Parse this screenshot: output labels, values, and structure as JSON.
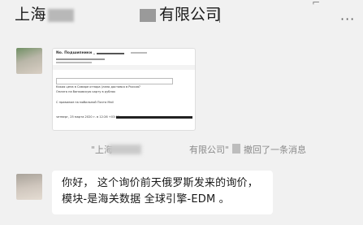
{
  "header": {
    "title_prefix": "上海",
    "title_suffix": "有限公司",
    "more_icon": "more-icon"
  },
  "messages": [
    {
      "type": "document",
      "preview": {
        "header_text": "No. Подшипники _ ",
        "line1": "Какая цена в Самаре отпора (лано доставка в Россия?",
        "line2": "Оплата на банковскую карту в рублях",
        "line3": "С правилом на мобильной Почта Mail",
        "date_line": "четверг, 25 марта 2020 г. в 12:26 +03:00"
      }
    },
    {
      "type": "recall",
      "open_quote": "\"上海",
      "middle": "有限公司\"",
      "tail": "撤回了一条消息"
    },
    {
      "type": "text",
      "text": "你好， 这个询价前天俄罗斯发来的询价， 模块-是海关数据 全球引擎-EDM 。"
    }
  ]
}
